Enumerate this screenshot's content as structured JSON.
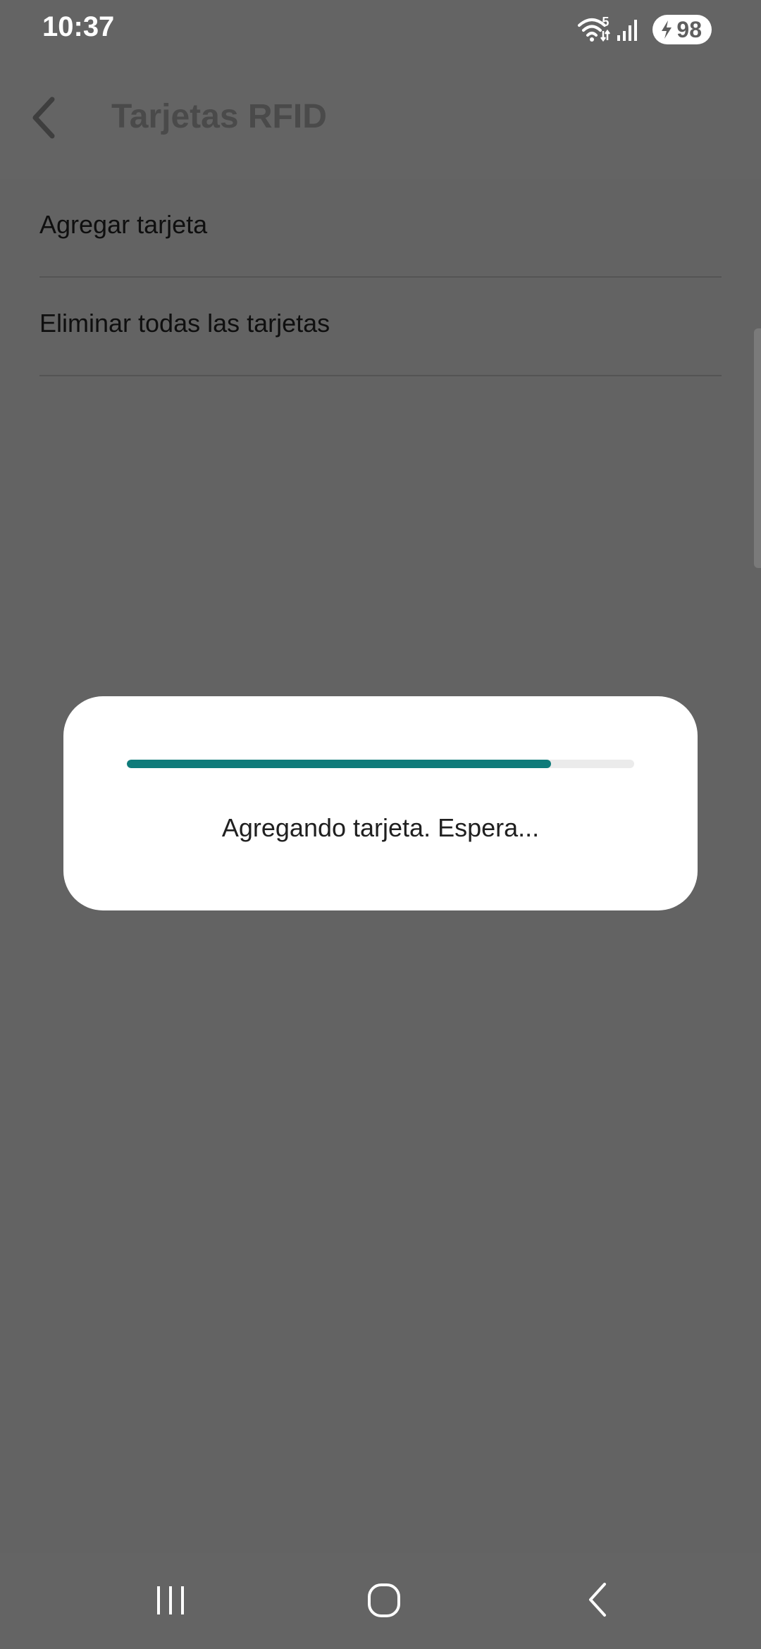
{
  "status_bar": {
    "time": "10:37",
    "battery": "98",
    "network_label": "5",
    "icons": [
      "wifi-icon",
      "signal-icon",
      "battery-charging-icon"
    ]
  },
  "app_bar": {
    "title": "Tarjetas RFID",
    "back_icon": "chevron-left-icon"
  },
  "menu": {
    "items": [
      {
        "label": "Agregar tarjeta"
      },
      {
        "label": "Eliminar todas las tarjetas"
      }
    ]
  },
  "dialog": {
    "message": "Agregando tarjeta. Espera...",
    "progress_fraction": 0.836,
    "progress_color": "#0f7b7a"
  },
  "nav_bar": {
    "buttons": [
      "recents-icon",
      "home-icon",
      "back-icon"
    ]
  },
  "colors": {
    "scrim": "#646464",
    "accent": "#0f7b7a"
  }
}
